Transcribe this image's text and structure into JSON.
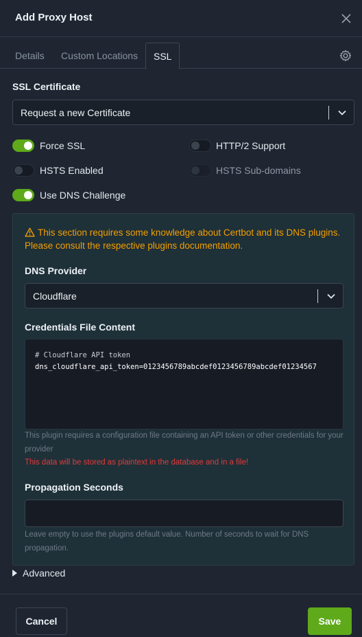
{
  "modal": {
    "title": "Add Proxy Host",
    "close_icon": "close-icon"
  },
  "tabs": [
    {
      "label": "Details",
      "active": false
    },
    {
      "label": "Custom Locations",
      "active": false
    },
    {
      "label": "SSL",
      "active": true
    }
  ],
  "settings_icon": "gear-icon",
  "ssl": {
    "certificate_label": "SSL Certificate",
    "certificate_value": "Request a new Certificate",
    "toggles": {
      "force_ssl": {
        "label": "Force SSL",
        "on": true
      },
      "http2": {
        "label": "HTTP/2 Support",
        "on": false
      },
      "hsts": {
        "label": "HSTS Enabled",
        "on": false
      },
      "hsts_sub": {
        "label": "HSTS Sub-domains",
        "on": false,
        "disabled": true
      },
      "dns_challenge": {
        "label": "Use DNS Challenge",
        "on": true
      }
    }
  },
  "dns": {
    "warning": "This section requires some knowledge about Certbot and its DNS plugins. Please consult the respective plugins documentation.",
    "provider_label": "DNS Provider",
    "provider_value": "Cloudflare",
    "credentials_label": "Credentials File Content",
    "credentials_line1": "# Cloudflare API token",
    "credentials_line2": "dns_cloudflare_api_token=0123456789abcdef0123456789abcdef01234567",
    "credentials_hint": "This plugin requires a configuration file containing an API token or other credentials for your provider",
    "credentials_danger": "This data will be stored as plaintext in the database and in a file!",
    "propagation_label": "Propagation Seconds",
    "propagation_value": "",
    "propagation_hint": "Leave empty to use the plugins default value. Number of seconds to wait for DNS propagation."
  },
  "advanced_label": "Advanced",
  "footer": {
    "cancel_label": "Cancel",
    "save_label": "Save"
  },
  "colors": {
    "accent": "#5eaa1a",
    "warning": "#f59f00",
    "danger": "#e03b3b",
    "background": "#1f2631",
    "panel": "#1e3038"
  }
}
